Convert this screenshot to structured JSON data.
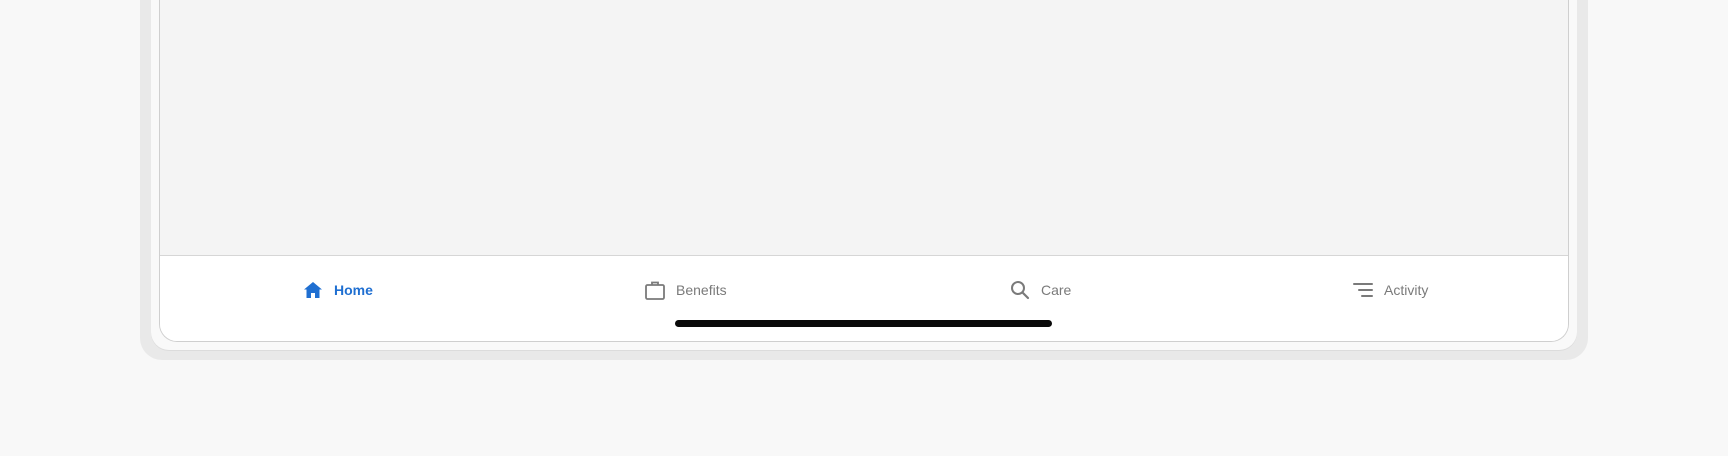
{
  "tab_bar": {
    "tabs": [
      {
        "label": "Home",
        "icon": "home-icon",
        "active": true
      },
      {
        "label": "Benefits",
        "icon": "briefcase-icon",
        "active": false
      },
      {
        "label": "Care",
        "icon": "search-icon",
        "active": false
      },
      {
        "label": "Activity",
        "icon": "activity-list-icon",
        "active": false
      }
    ]
  },
  "colors": {
    "accent": "#1f6fd1",
    "inactive": "#7a7a7a",
    "background": "#f4f4f4",
    "tab_bar_bg": "#ffffff"
  }
}
